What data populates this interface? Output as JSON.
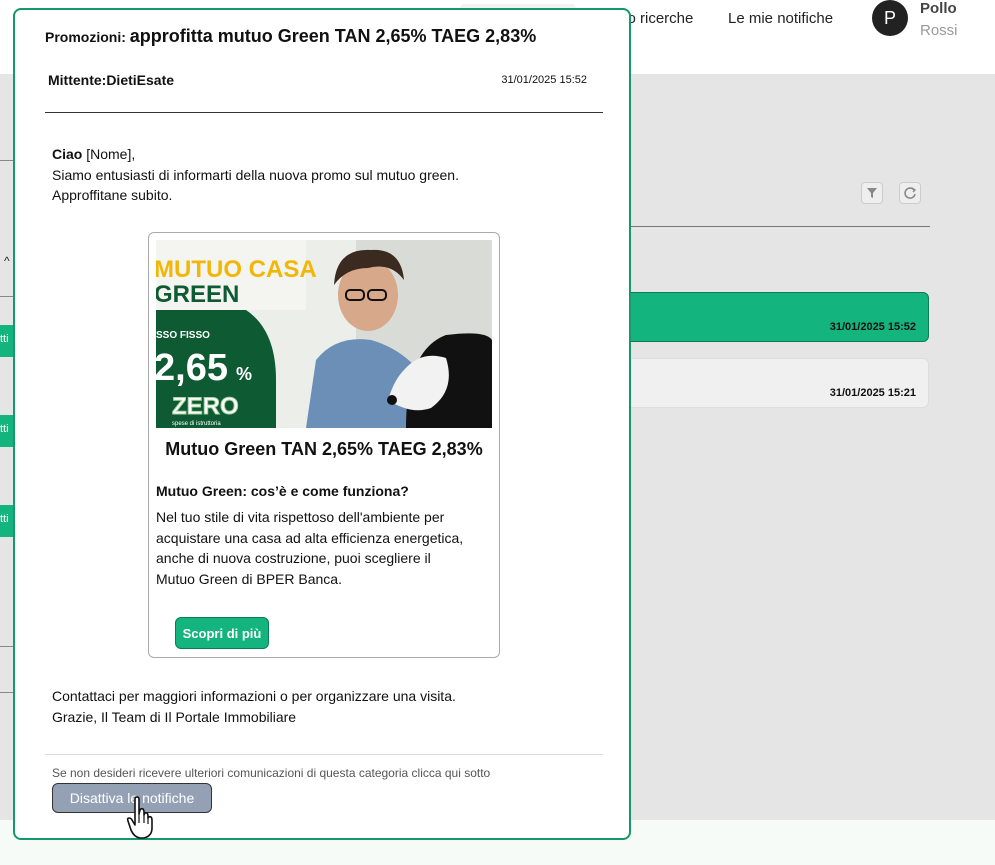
{
  "topbar": {
    "nav_search": "co ricerche",
    "nav_notifications": "Le mie notifiche",
    "user_initial": "P",
    "user_first": "Pollo",
    "user_last": "Rossi"
  },
  "list": {
    "rows": [
      {
        "date": "31/01/2025 15:52",
        "selected": true
      },
      {
        "date": "31/01/2025 15:21",
        "selected": false
      }
    ],
    "left_strip_labels": [
      "tti",
      "tti",
      "tti"
    ],
    "icons": [
      "filter-icon",
      "refresh-icon"
    ]
  },
  "modal": {
    "category": "Promozioni",
    "subject": "approfitta  mutuo Green TAN 2,65% TAEG 2,83%",
    "sender": "Mittente:DietiEsate",
    "date": "31/01/2025 15:52",
    "greeting_bold": "Ciao",
    "greeting_rest": " [Nome],",
    "intro_line1": "Siamo entusiasti di informarti della nuova promo sul mutuo green.",
    "intro_line2": "Approffitane subito.",
    "promo": {
      "img_line1": "MUTUO CASA",
      "img_line2": "GREEN",
      "img_tasso": "SSO FISSO",
      "img_rate": "2,65",
      "img_pct": "%",
      "img_zero": "ZERO",
      "img_spese": "spese di istruttoria",
      "headline": "Mutuo Green TAN 2,65% TAEG 2,83%",
      "subheading": "Mutuo Green: cos’è e come funziona?",
      "description": "Nel tuo stile di vita rispettoso dell'ambiente per acquistare una casa ad alta efficienza energetica, anche di nuova costruzione, puoi scegliere il Mutuo Green di BPER Banca.",
      "button": "Scopri di più"
    },
    "closing_line1": "Contattaci per maggiori informazioni o per organizzare una visita.",
    "closing_line2": "Grazie, Il Team di Il Portale Immobiliare",
    "unsubscribe_note": "Se non desideri ricevere ulteriori comunicazioni di questa categoria clicca qui sotto",
    "disable_button": "Disattiva le notifiche"
  },
  "colors": {
    "accent": "#14b47e",
    "modal_border": "#14996c",
    "brand_dark_green": "#0d5a33",
    "disable_button": "#94a1b5"
  }
}
